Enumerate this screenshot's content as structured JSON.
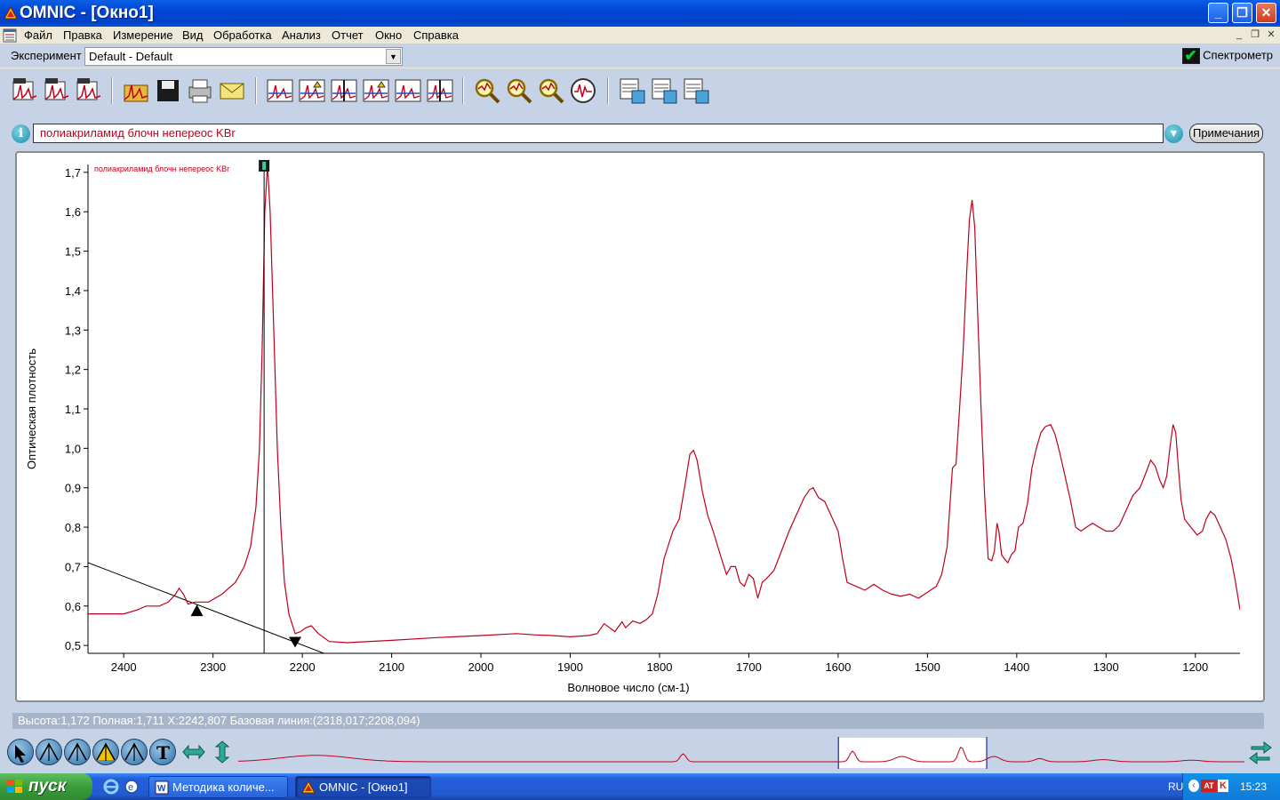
{
  "window": {
    "title": "OMNIC - [Окно1]",
    "buttons": {
      "minimize": "_",
      "maximize": "❐",
      "close": "✕"
    }
  },
  "menu": {
    "items": [
      "Файл",
      "Правка",
      "Измерение",
      "Вид",
      "Обработка",
      "Анализ",
      "Отчет",
      "Окно",
      "Справка"
    ]
  },
  "experiment": {
    "label": "Эксперимент",
    "value": "Default - Default",
    "spectrometer_label": "Спектрометр",
    "spectrometer_status_color": "#0DCB2A"
  },
  "toolbar": {
    "icons": [
      "collect-sample-icon",
      "collect-background-icon",
      "collect-series-icon",
      "open-icon",
      "save-icon",
      "print-icon",
      "mail-icon",
      "baseline-correct-icon",
      "automatic-baseline-icon",
      "normalize-scale-icon",
      "subtract-icon",
      "offset-icon",
      "find-peaks-icon",
      "search-library-icon",
      "quantify-icon",
      "zoom-search-icon",
      "qcheck-icon",
      "macros-icon",
      "macro-run-icon",
      "macro-edit-icon"
    ]
  },
  "info": {
    "spectrum_title": "полиакриламид блочн непереос KBr",
    "notes_button": "Примечания"
  },
  "chart_data": {
    "type": "line",
    "title": "полиакриламид блочн непереос KBr",
    "xlabel": "Волновое число (см-1)",
    "ylabel": "Оптическая плотность",
    "xlim": [
      2440,
      1150
    ],
    "ylim": [
      0.48,
      1.72
    ],
    "x_reversed": true,
    "x_ticks": [
      "2400",
      "2300",
      "2200",
      "2100",
      "2000",
      "1900",
      "1800",
      "1700",
      "1600",
      "1500",
      "1400",
      "1300",
      "1200"
    ],
    "y_ticks": [
      "1,7",
      "1,6",
      "1,5",
      "1,4",
      "1,3",
      "1,2",
      "1,1",
      "1,0",
      "0,9",
      "0,8",
      "0,7",
      "0,6",
      "0,5"
    ],
    "series_color": "#C0001B",
    "series": [
      {
        "name": "полиакриламид блочн непереос KBr",
        "x": [
          2440,
          2400,
          2385,
          2375,
          2360,
          2350,
          2342,
          2338,
          2333,
          2328,
          2320,
          2305,
          2290,
          2275,
          2265,
          2258,
          2252,
          2248,
          2245,
          2242,
          2239,
          2236,
          2232,
          2228,
          2224,
          2220,
          2215,
          2208,
          2202,
          2196,
          2190,
          2182,
          2170,
          2150,
          2100,
          2050,
          2000,
          1960,
          1940,
          1920,
          1900,
          1880,
          1870,
          1862,
          1850,
          1842,
          1838,
          1830,
          1822,
          1815,
          1808,
          1802,
          1795,
          1785,
          1778,
          1772,
          1766,
          1762,
          1758,
          1752,
          1746,
          1740,
          1732,
          1725,
          1720,
          1715,
          1710,
          1705,
          1700,
          1695,
          1690,
          1685,
          1680,
          1672,
          1665,
          1655,
          1645,
          1638,
          1632,
          1628,
          1622,
          1615,
          1608,
          1600,
          1595,
          1590,
          1580,
          1570,
          1560,
          1550,
          1540,
          1530,
          1520,
          1510,
          1500,
          1490,
          1484,
          1478,
          1472,
          1468,
          1464,
          1460,
          1456,
          1453,
          1450,
          1447,
          1444,
          1440,
          1436,
          1432,
          1428,
          1425,
          1422,
          1420,
          1417,
          1414,
          1410,
          1406,
          1402,
          1398,
          1393,
          1388,
          1383,
          1378,
          1373,
          1368,
          1362,
          1357,
          1352,
          1346,
          1340,
          1334,
          1328,
          1322,
          1315,
          1308,
          1300,
          1292,
          1285,
          1278,
          1270,
          1262,
          1255,
          1250,
          1245,
          1240,
          1236,
          1232,
          1228,
          1225,
          1222,
          1219,
          1216,
          1212,
          1205,
          1198,
          1192,
          1188,
          1183,
          1178,
          1172,
          1166,
          1160,
          1155,
          1150
        ],
        "y": [
          0.58,
          0.58,
          0.59,
          0.6,
          0.6,
          0.61,
          0.63,
          0.645,
          0.63,
          0.605,
          0.61,
          0.61,
          0.63,
          0.66,
          0.7,
          0.75,
          0.85,
          1.0,
          1.25,
          1.6,
          1.72,
          1.6,
          1.3,
          1.0,
          0.8,
          0.66,
          0.58,
          0.53,
          0.535,
          0.545,
          0.55,
          0.53,
          0.51,
          0.507,
          0.513,
          0.52,
          0.525,
          0.53,
          0.527,
          0.525,
          0.522,
          0.525,
          0.53,
          0.555,
          0.535,
          0.56,
          0.545,
          0.562,
          0.556,
          0.565,
          0.58,
          0.63,
          0.72,
          0.79,
          0.82,
          0.9,
          0.985,
          0.995,
          0.97,
          0.89,
          0.83,
          0.79,
          0.73,
          0.68,
          0.7,
          0.7,
          0.66,
          0.65,
          0.68,
          0.67,
          0.62,
          0.66,
          0.67,
          0.69,
          0.73,
          0.79,
          0.84,
          0.875,
          0.895,
          0.9,
          0.875,
          0.865,
          0.83,
          0.79,
          0.72,
          0.66,
          0.65,
          0.64,
          0.655,
          0.64,
          0.63,
          0.625,
          0.63,
          0.62,
          0.635,
          0.65,
          0.68,
          0.75,
          0.95,
          0.96,
          1.1,
          1.25,
          1.45,
          1.58,
          1.63,
          1.56,
          1.36,
          1.1,
          0.88,
          0.72,
          0.715,
          0.74,
          0.81,
          0.79,
          0.73,
          0.72,
          0.71,
          0.73,
          0.74,
          0.8,
          0.81,
          0.86,
          0.95,
          1.0,
          1.04,
          1.055,
          1.06,
          1.035,
          0.99,
          0.93,
          0.87,
          0.8,
          0.79,
          0.8,
          0.81,
          0.8,
          0.79,
          0.79,
          0.805,
          0.84,
          0.88,
          0.9,
          0.94,
          0.97,
          0.955,
          0.92,
          0.9,
          0.93,
          1.01,
          1.06,
          1.04,
          0.95,
          0.87,
          0.82,
          0.8,
          0.78,
          0.79,
          0.82,
          0.84,
          0.83,
          0.8,
          0.77,
          0.72,
          0.66,
          0.59
        ],
        "color": "#C0001B"
      }
    ],
    "baseline_line": {
      "x": [
        2440,
        2170
      ],
      "y": [
        0.71,
        0.475
      ]
    },
    "cursor_x": 2242.807,
    "baseline_markers": [
      2318.017,
      2208.094
    ]
  },
  "status": {
    "text": "Высота:1,172 Полная:1,711 X:2242,807 Базовая линия:(2318,017;2208,094)"
  },
  "overview": {
    "tools": [
      "pointer-icon",
      "region-icon",
      "peak-height-icon",
      "peak-area-icon",
      "find-peaks-tool-icon",
      "text-label-icon",
      "expand-horizontal-icon",
      "expand-vertical-icon"
    ],
    "selection_range": [
      1800,
      1380
    ]
  },
  "taskbar": {
    "start": "пуск",
    "tasks": [
      "Методика количе...",
      "OMNIC - [Окно1]"
    ],
    "tray": {
      "lang": "RU",
      "time": "15:23"
    }
  }
}
